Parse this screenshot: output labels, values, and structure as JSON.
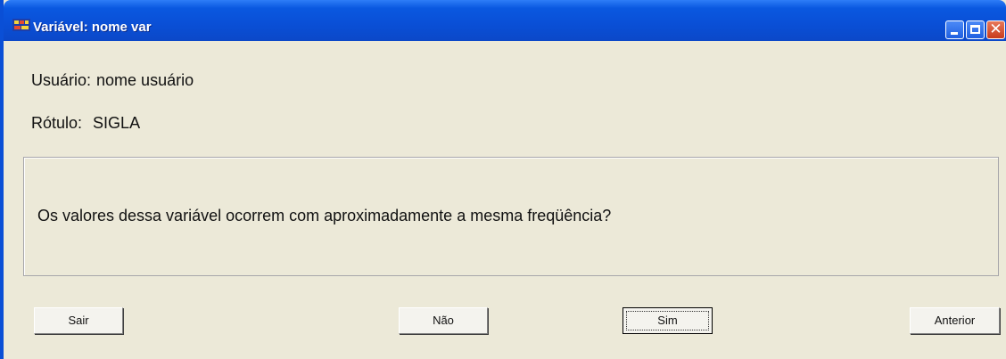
{
  "window": {
    "title": "Variável: nome var",
    "icon": "app-icon"
  },
  "titlebar_buttons": {
    "minimize": "minimize-icon",
    "maximize": "maximize-icon",
    "close_glyph": "✕"
  },
  "user": {
    "label": "Usuário:",
    "value": "nome usuário"
  },
  "rotulo": {
    "label": "Rótulo:",
    "value": "SIGLA"
  },
  "question": {
    "text": "Os valores dessa variável ocorrem com aproximadamente a mesma freqüência?"
  },
  "buttons": {
    "sair": "Sair",
    "nao": "Não",
    "sim": "Sim",
    "anterior": "Anterior"
  },
  "colors": {
    "titlebar": "#0a4fd6",
    "window_bg": "#ece9d8",
    "close_button": "#c83b1c"
  }
}
